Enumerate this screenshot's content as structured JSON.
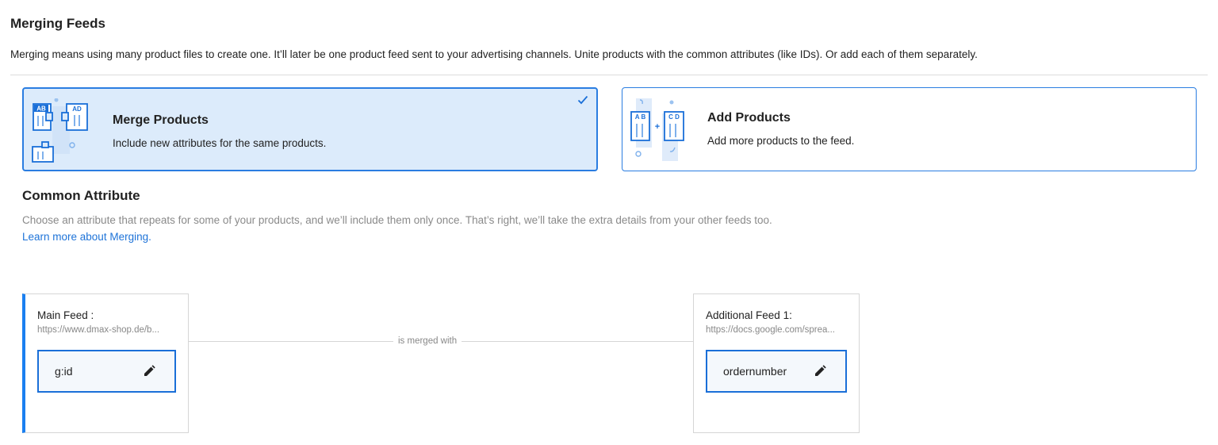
{
  "header": {
    "title": "Merging Feeds",
    "description": "Merging means using many product files to create one. It’ll later be one product feed sent to your advertising channels. Unite products with the common attributes (like IDs). Or add each of them separately."
  },
  "options": [
    {
      "title": "Merge Products",
      "subtitle": "Include new attributes for the same products.",
      "selected": true,
      "illustration_labels": [
        "AB",
        "AD"
      ],
      "icon": "merge-products-illustration"
    },
    {
      "title": "Add Products",
      "subtitle": "Add more products to the feed.",
      "selected": false,
      "illustration_labels": [
        "A B",
        "C D"
      ],
      "icon": "add-products-illustration"
    }
  ],
  "common_attribute": {
    "title": "Common Attribute",
    "description": "Choose an attribute that repeats for some of your products, and we’ll include them only once. That’s right, we’ll take the extra details from your other feeds too.",
    "link_text": "Learn more about Merging."
  },
  "merge": {
    "connector_label": "is merged with",
    "main_feed": {
      "label": "Main Feed :",
      "url": "https://www.dmax-shop.de/b...",
      "attribute": "g:id"
    },
    "additional_feed": {
      "label": "Additional Feed 1:",
      "url": "https://docs.google.com/sprea...",
      "attribute": "ordernumber"
    }
  },
  "colors": {
    "accent": "#2a7de1",
    "selected_bg": "#dcebfb",
    "link": "#1e73d8",
    "main_feed_bar": "#1a7ff0"
  }
}
